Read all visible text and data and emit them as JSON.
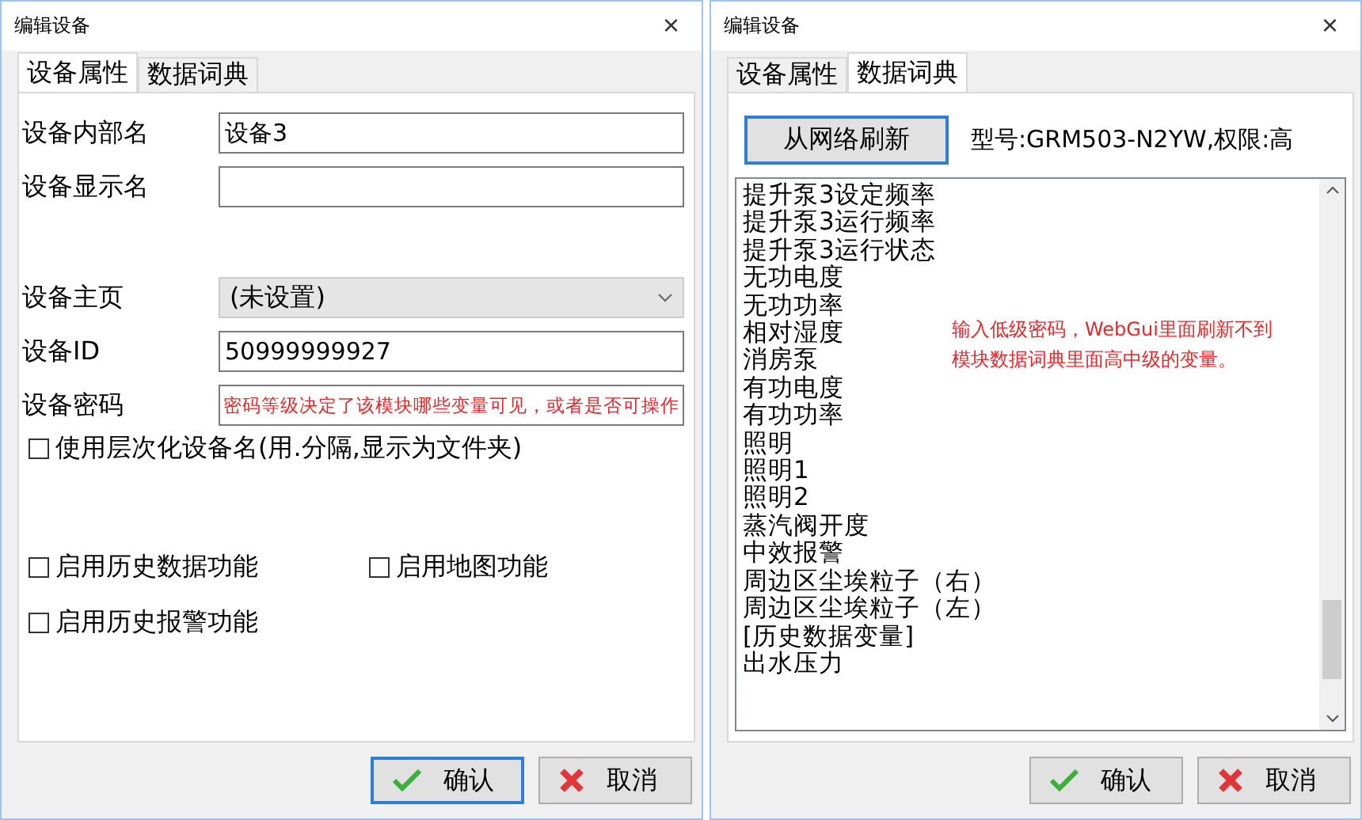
{
  "dialogs": [
    {
      "kind": "properties",
      "title": "编辑设备",
      "close": "×",
      "tabs": [
        {
          "label": "设备属性",
          "selected": true
        },
        {
          "label": "数据词典",
          "selected": false
        }
      ],
      "fields": [
        {
          "label": "设备内部名",
          "value": "设备3",
          "kind": "text"
        },
        {
          "label": "设备显示名",
          "kind": "text"
        },
        {
          "label": "设备主页",
          "value": "(未设置)",
          "kind": "select"
        },
        {
          "label": "设备ID",
          "value": "50999999927",
          "kind": "text"
        },
        {
          "label": "设备密码",
          "kind": "text",
          "note": "密码等级决定了该模块哪些变量可见，或者是否可操作"
        }
      ],
      "hierarchy_option": {
        "label": "使用层次化设备名(用.分隔,显示为文件夹)",
        "checked": false
      },
      "feature_options": [
        {
          "label": "启用历史数据功能",
          "checked": false
        },
        {
          "label": "启用地图功能",
          "checked": false
        },
        {
          "label": "启用历史报警功能",
          "checked": false
        }
      ],
      "buttons": [
        {
          "label": "确认",
          "kind": "ok",
          "focused": true
        },
        {
          "label": "取消",
          "kind": "cancel",
          "focused": false
        }
      ]
    },
    {
      "kind": "dictionary",
      "title": "编辑设备",
      "close": "×",
      "tabs": [
        {
          "label": "设备属性",
          "selected": false
        },
        {
          "label": "数据词典",
          "selected": true
        }
      ],
      "refresh_button": "从网络刷新",
      "model_info": "型号:GRM503-N2YW,权限:高",
      "items": [
        "提升泵3设定频率",
        "提升泵3运行频率",
        "提升泵3运行状态",
        "无功电度",
        "无功功率",
        "相对湿度",
        "消房泵",
        "有功电度",
        "有功功率",
        "照明",
        "照明1",
        "照明2",
        "蒸汽阀开度",
        "中效报警",
        "周边区尘埃粒子（右）",
        "周边区尘埃粒子（左）",
        "[历史数据变量]",
        "出水压力"
      ],
      "note": "输入低级密码，WebGui里面刷新不到模块数据词典里面高中级的变量。",
      "buttons": [
        {
          "label": "确认",
          "kind": "ok",
          "focused": false
        },
        {
          "label": "取消",
          "kind": "cancel",
          "focused": false
        }
      ]
    }
  ]
}
